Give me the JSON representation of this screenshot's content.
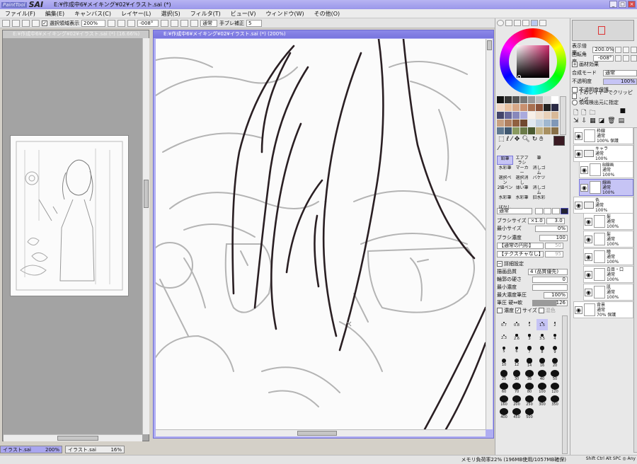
{
  "app": {
    "logo_small": "PaintTool",
    "logo_big": "SAI",
    "title": "E:¥作成中6¥メイキング¥02¥イラスト.sai (*)"
  },
  "window_controls": {
    "minimize": "_",
    "maximize": "□",
    "close": "×"
  },
  "menu": [
    "ファイル(F)",
    "編集(E)",
    "キャンバス(C)",
    "レイヤー(L)",
    "選択(S)",
    "フィルタ(T)",
    "ビュー(V)",
    "ウィンドウ(W)",
    "その他(O)"
  ],
  "toolbar": {
    "selection_display_label": "選択領域表示",
    "zoom_value": "200%",
    "rotation_value": "-008°",
    "blend_mode": "通常",
    "stabilizer_label": "手ブレ補正",
    "stabilizer_value": "5"
  },
  "left_window": {
    "title": "E:¥作成中6¥メイキング¥02¥イラスト.sai (*) (16.66%)"
  },
  "main_window": {
    "title": "E:¥作成中6¥メイキング¥02¥イラスト.sai (*) (200%)"
  },
  "tasks": [
    {
      "name": "イラスト.sai",
      "zoom": "200%"
    },
    {
      "name": "イラスト.sai",
      "zoom": "16%"
    }
  ],
  "status": {
    "memory": "メモリ負荷率22% (196MB使用/1057MB確保)",
    "keys": "Shift Ctrl Alt SPC ◎ Any"
  },
  "navigator": {
    "zoom_label": "表示倍率",
    "zoom_value": "200.0%",
    "angle_label": "回転角度",
    "angle_value": "-008°"
  },
  "layer_props": {
    "texture_label": "画材効果",
    "blend_label": "合成モード",
    "blend_value": "通常",
    "opacity_label": "不透明度",
    "opacity_value": "100%",
    "options": [
      "不透明度保護",
      "下のレイヤーでクリッピング",
      "領域検出元に指定"
    ]
  },
  "tools": [
    "鉛筆",
    "エアブラシ",
    "筆",
    "水彩筆",
    "マーカー",
    "消しゴム",
    "選択ペン",
    "選択消し",
    "バケツ",
    "2値ペン",
    "薄い筆",
    "消しゴム",
    "水彩筆",
    "水彩筆",
    "旧水彩",
    "ぼかし"
  ],
  "brush": {
    "mode": "通常",
    "size_label": "ブラシサイズ",
    "size_mult": "×1.0",
    "size_value": "3.0",
    "min_size_label": "最小サイズ",
    "min_size_value": "0%",
    "density_label": "ブラシ濃度",
    "density_value": "100",
    "shape_value": "【通常の円形】",
    "texture_value": "【テクスチャなし】",
    "shape_strength": "50",
    "texture_strength": "95",
    "detail_label": "詳細設定",
    "quality_label": "描画品質",
    "quality_value": "4 (品質優先)",
    "edge_label": "輪郭の硬さ",
    "edge_value": "0",
    "min_density_label": "最小濃度",
    "max_density_label": "最大濃度筆圧",
    "max_density_value": "100%",
    "pressure_label": "筆圧 硬⇔軟",
    "pressure_value": "126",
    "pressure_density": "濃度",
    "pressure_size": "サイズ",
    "pressure_blend": "混色"
  },
  "brush_sizes": [
    [
      "0.7",
      "0.8",
      "1",
      "1.5",
      "2"
    ],
    [
      "2.3",
      "2.6",
      "3",
      "3.5",
      "4"
    ],
    [
      "5",
      "6",
      "7",
      "8",
      "9"
    ],
    [
      "10",
      "12",
      "14",
      "16",
      "20"
    ],
    [
      "25",
      "30",
      "35",
      "40",
      "50"
    ],
    [
      "60",
      "70",
      "80",
      "100",
      "120"
    ],
    [
      "160",
      "200",
      "250",
      "300",
      "350"
    ],
    [
      "400",
      "450",
      "500",
      "",
      ""
    ]
  ],
  "layers": [
    {
      "name": "枠線",
      "mode": "通常",
      "opacity": "100% 保護",
      "type": "layer",
      "selected": false
    },
    {
      "name": "キャラ",
      "mode": "通常",
      "opacity": "100%",
      "type": "folder",
      "selected": false
    },
    {
      "name": "B線画",
      "mode": "通常",
      "opacity": "100%",
      "type": "layer",
      "selected": false
    },
    {
      "name": "線画",
      "mode": "通常",
      "opacity": "100%",
      "type": "layer",
      "selected": true
    },
    {
      "name": "色",
      "mode": "通常",
      "opacity": "100%",
      "type": "folder",
      "selected": false
    },
    {
      "name": "髪",
      "mode": "通常",
      "opacity": "100%",
      "type": "layer",
      "selected": false
    },
    {
      "name": "髪",
      "mode": "通常",
      "opacity": "100%",
      "type": "layer",
      "selected": false
    },
    {
      "name": "瞳",
      "mode": "通常",
      "opacity": "100%",
      "type": "layer",
      "selected": false
    },
    {
      "name": "白目・口",
      "mode": "通常",
      "opacity": "100%",
      "type": "layer",
      "selected": false
    },
    {
      "name": "肌",
      "mode": "通常",
      "opacity": "100%",
      "type": "layer",
      "selected": false
    },
    {
      "name": "背景",
      "mode": "通常",
      "opacity": "70% 保護",
      "type": "layer",
      "selected": false
    }
  ],
  "colors": {
    "accent": "#9a97ea",
    "current_color": "#3a1a22",
    "selected_layer": "#c6c4f5"
  }
}
